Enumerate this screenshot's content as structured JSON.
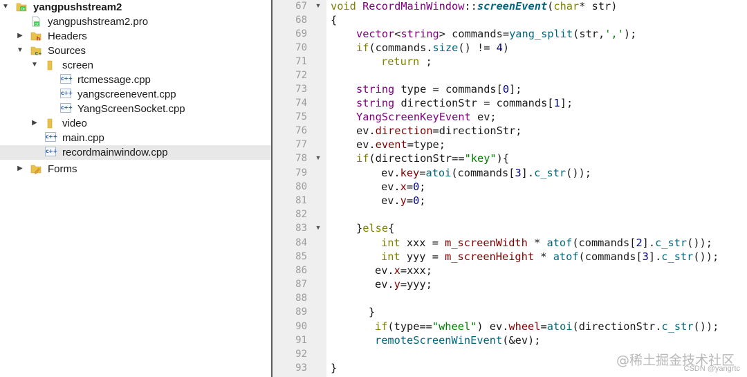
{
  "project_tree": {
    "root": {
      "label": "yangpushstream2"
    },
    "pro_file": {
      "label": "yangpushstream2.pro"
    },
    "headers": {
      "label": "Headers"
    },
    "sources": {
      "label": "Sources"
    },
    "screen": {
      "label": "screen"
    },
    "screen_files": [
      {
        "label": "rtcmessage.cpp"
      },
      {
        "label": "yangscreenevent.cpp"
      },
      {
        "label": "YangScreenSocket.cpp"
      }
    ],
    "video": {
      "label": "video"
    },
    "main_cpp": {
      "label": "main.cpp"
    },
    "recordmainwindow_cpp": {
      "label": "recordmainwindow.cpp",
      "selected": true
    },
    "forms": {
      "label": "Forms"
    }
  },
  "editor": {
    "line_numbers": [
      "67",
      "68",
      "69",
      "70",
      "71",
      "72",
      "73",
      "74",
      "75",
      "76",
      "77",
      "78",
      "79",
      "80",
      "81",
      "82",
      "83",
      "84",
      "85",
      "86",
      "87",
      "88",
      "89",
      "90",
      "91",
      "92",
      "93"
    ],
    "fold_markers": [
      "67",
      "78",
      "83"
    ],
    "lines": {
      "l67": {
        "t1": "void",
        "t2": "RecordMainWindow",
        "t3": "::",
        "t4": "screenEvent",
        "t5": "(",
        "t6": "char",
        "t7": "* str)"
      },
      "l68": {
        "t1": "{"
      },
      "l69": {
        "t1": "vector",
        "t2": "<",
        "t3": "string",
        "t4": "> commands=",
        "t5": "yang_split",
        "t6": "(str,",
        "t7": "','",
        "t8": ");"
      },
      "l70": {
        "t1": "if",
        "t2": "(commands.",
        "t3": "size",
        "t4": "() != ",
        "t5": "4",
        "t6": ")"
      },
      "l71": {
        "t1": "return",
        "t2": " ;"
      },
      "l73": {
        "t1": "string",
        "t2": " type = commands[",
        "t3": "0",
        "t4": "];"
      },
      "l74": {
        "t1": "string",
        "t2": " directionStr = commands[",
        "t3": "1",
        "t4": "];"
      },
      "l75": {
        "t1": "YangScreenKeyEvent",
        "t2": " ev;"
      },
      "l76": {
        "t1": "ev.",
        "t2": "direction",
        "t3": "=directionStr;"
      },
      "l77": {
        "t1": "ev.",
        "t2": "event",
        "t3": "=type;"
      },
      "l78": {
        "t1": "if",
        "t2": "(directionStr==",
        "t3": "\"key\"",
        "t4": "){"
      },
      "l79": {
        "t1": "ev.",
        "t2": "key",
        "t3": "=",
        "t4": "atoi",
        "t5": "(commands[",
        "t6": "3",
        "t7": "].",
        "t8": "c_str",
        "t9": "());"
      },
      "l80": {
        "t1": "ev.",
        "t2": "x",
        "t3": "=",
        "t4": "0",
        "t5": ";"
      },
      "l81": {
        "t1": "ev.",
        "t2": "y",
        "t3": "=",
        "t4": "0",
        "t5": ";"
      },
      "l83": {
        "t1": "}",
        "t2": "else",
        "t3": "{"
      },
      "l84": {
        "t1": "int",
        "t2": " xxx = ",
        "t3": "m_screenWidth",
        "t4": " * ",
        "t5": "atof",
        "t6": "(commands[",
        "t7": "2",
        "t8": "].",
        "t9": "c_str",
        "t10": "());"
      },
      "l85": {
        "t1": "int",
        "t2": " yyy = ",
        "t3": "m_screenHeight",
        "t4": " * ",
        "t5": "atof",
        "t6": "(commands[",
        "t7": "3",
        "t8": "].",
        "t9": "c_str",
        "t10": "());"
      },
      "l86": {
        "t1": "ev.",
        "t2": "x",
        "t3": "=xxx;"
      },
      "l87": {
        "t1": "ev.",
        "t2": "y",
        "t3": "=yyy;"
      },
      "l89": {
        "t1": "}"
      },
      "l90": {
        "t1": "if",
        "t2": "(type==",
        "t3": "\"wheel\"",
        "t4": ") ev.",
        "t5": "wheel",
        "t6": "=",
        "t7": "atoi",
        "t8": "(directionStr.",
        "t9": "c_str",
        "t10": "());"
      },
      "l91": {
        "t1": "remoteScreenWinEvent",
        "t2": "(&ev);"
      },
      "l93": {
        "t1": "}"
      }
    }
  },
  "watermark": {
    "text": "@稀土掘金技术社区",
    "sub": "CSDN @yangrtc"
  },
  "colors": {
    "keyword": "#808000",
    "type": "#800080",
    "function": "#00677c",
    "member": "#800000",
    "string": "#008000",
    "number": "#000080"
  }
}
